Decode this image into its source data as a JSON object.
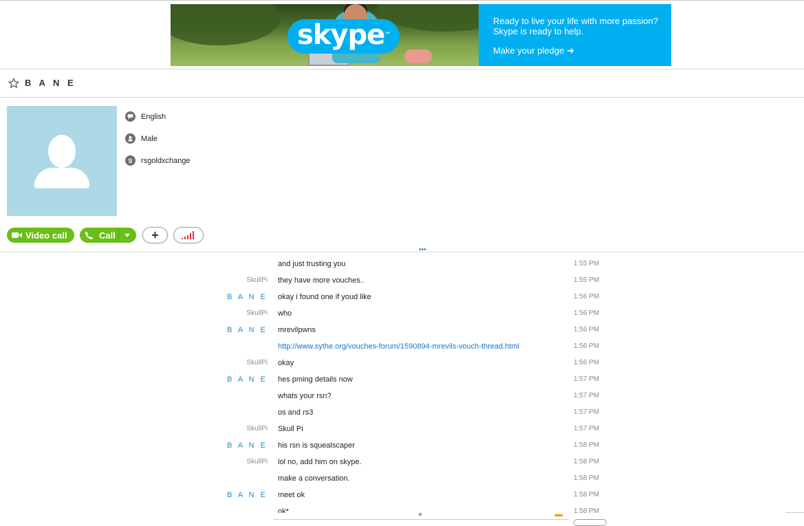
{
  "ad": {
    "logo": "skype",
    "headline_line1": "Ready to live your life with more passion?",
    "headline_line2": "Skype is ready to help.",
    "cta": "Make your pledge ➜",
    "brand_color": "#00aff0"
  },
  "contact": {
    "name": "B A N E",
    "language": "English",
    "gender": "Male",
    "skype_name": "rsgoldxchange"
  },
  "actions": {
    "video_call_label": "Video call",
    "call_label": "Call",
    "add_label": "+",
    "accent_color": "#6abf17"
  },
  "messages": [
    {
      "sender": "",
      "text": "and just trusting you",
      "time": "1:55 PM"
    },
    {
      "sender": "SkullPi",
      "text": "they have more vouches..",
      "time": "1:55 PM"
    },
    {
      "sender": "B A N E",
      "text": "okay i found one if youd like",
      "time": "1:56 PM"
    },
    {
      "sender": "SkullPi",
      "text": "who",
      "time": "1:56 PM"
    },
    {
      "sender": "B A N E",
      "text": "mrevilpwns",
      "time": "1:56 PM"
    },
    {
      "sender": "",
      "text": "http://www.sythe.org/vouches-forum/1590894-mrevils-vouch-thread.html",
      "time": "1:56 PM",
      "link": true
    },
    {
      "sender": "SkullPi",
      "text": "okay",
      "time": "1:56 PM"
    },
    {
      "sender": "B A N E",
      "text": "hes pming details now",
      "time": "1:57 PM"
    },
    {
      "sender": "",
      "text": "whats your rsn?",
      "time": "1:57 PM"
    },
    {
      "sender": "",
      "text": "os and rs3",
      "time": "1:57 PM"
    },
    {
      "sender": "SkullPi",
      "text": "Skull Pi",
      "time": "1:57 PM"
    },
    {
      "sender": "B A N E",
      "text": "his rsn is squealscaper",
      "time": "1:58 PM"
    },
    {
      "sender": "SkullPi",
      "text": "lol no, add him on skype.",
      "time": "1:58 PM"
    },
    {
      "sender": "",
      "text": "make a conversation.",
      "time": "1:58 PM"
    },
    {
      "sender": "B A N E",
      "text": "meet ok",
      "time": "1:58 PM"
    },
    {
      "sender": "",
      "text": "ok*",
      "time": "1:58 PM"
    }
  ],
  "compose": {
    "more_label": "•••"
  }
}
